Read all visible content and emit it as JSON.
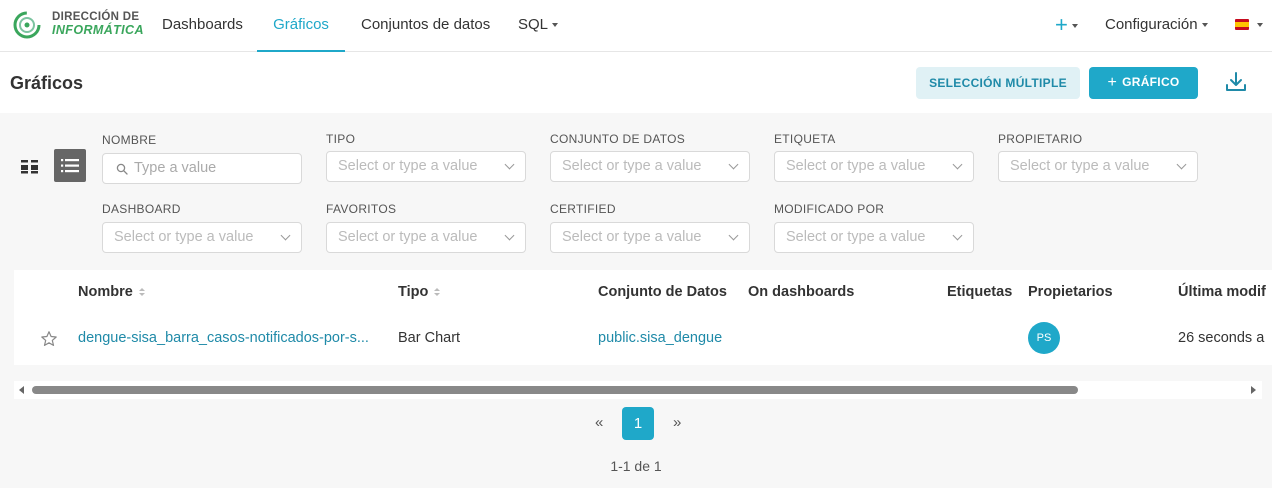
{
  "brand": {
    "line1": "DIRECCIÓN DE",
    "line2": "INFORMÁTICA"
  },
  "nav": {
    "dashboards": "Dashboards",
    "charts": "Gráficos",
    "datasets": "Conjuntos de datos",
    "sql": "SQL",
    "settings": "Configuración",
    "plus": "+"
  },
  "header": {
    "title": "Gráficos",
    "bulk_select": "SELECCIÓN MÚLTIPLE",
    "add_chart": "GRÁFICO",
    "add_chart_plus": "+"
  },
  "filters": {
    "name": {
      "label": "NOMBRE",
      "placeholder": "Type a value"
    },
    "type": {
      "label": "TIPO",
      "placeholder": "Select or type a value"
    },
    "dataset": {
      "label": "CONJUNTO DE DATOS",
      "placeholder": "Select or type a value"
    },
    "tag": {
      "label": "ETIQUETA",
      "placeholder": "Select or type a value"
    },
    "owner": {
      "label": "PROPIETARIO",
      "placeholder": "Select or type a value"
    },
    "dashboard": {
      "label": "DASHBOARD",
      "placeholder": "Select or type a value"
    },
    "favorites": {
      "label": "FAVORITOS",
      "placeholder": "Select or type a value"
    },
    "certified": {
      "label": "CERTIFIED",
      "placeholder": "Select or type a value"
    },
    "modified_by": {
      "label": "MODIFICADO POR",
      "placeholder": "Select or type a value"
    }
  },
  "table": {
    "columns": [
      "Nombre",
      "Tipo",
      "Conjunto de Datos",
      "On dashboards",
      "Etiquetas",
      "Propietarios",
      "Última modif"
    ],
    "rows": [
      {
        "name": "dengue-sisa_barra_casos-notificados-por-s...",
        "type": "Bar Chart",
        "dataset": "public.sisa_dengue",
        "owner_initials": "PS",
        "modified": "26 seconds a"
      }
    ]
  },
  "pagination": {
    "prev": "«",
    "current": "1",
    "next": "»",
    "range": "1-1 de 1"
  },
  "colors": {
    "primary": "#1fa8c9",
    "secondary_bg": "#e0f1f5",
    "brand_green": "#3aa65c"
  }
}
